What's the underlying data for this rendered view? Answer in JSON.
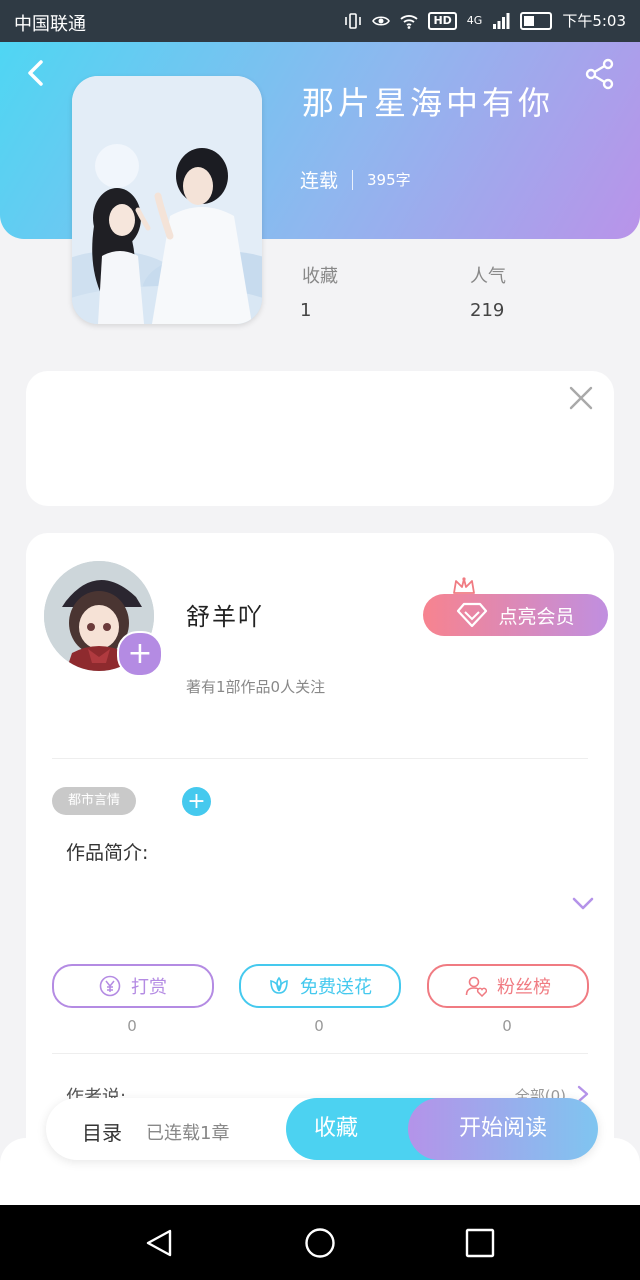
{
  "status_bar": {
    "carrier": "中国联通",
    "network": "4G",
    "hd": "HD",
    "time": "下午5:03"
  },
  "book": {
    "title": "那片星海中有你",
    "status": "连载",
    "word_count": "395字",
    "stats": [
      {
        "label": "收藏",
        "value": "1"
      },
      {
        "label": "人气",
        "value": "219"
      }
    ]
  },
  "author": {
    "name": "舒羊吖",
    "info": "著有1部作品0人关注",
    "follow_glyph": "+",
    "vip_label": "点亮会员"
  },
  "tags": [
    "都市言情"
  ],
  "tag_add_glyph": "+",
  "intro_label": "作品简介:",
  "actions": [
    {
      "label": "打赏",
      "count": "0",
      "icon": "yen-icon",
      "color": "#b48be3"
    },
    {
      "label": "免费送花",
      "count": "0",
      "icon": "flower-icon",
      "color": "#45c9ee"
    },
    {
      "label": "粉丝榜",
      "count": "0",
      "icon": "user-heart-icon",
      "color": "#f07b82"
    }
  ],
  "author_said": {
    "label": "作者说:",
    "chapters": "全部(0)"
  },
  "bottom_bar": {
    "toc_label": "目录",
    "toc_status": "已连载1章",
    "collect_label": "收藏",
    "read_label": "开始阅读"
  },
  "colors": {
    "accent_blue": "#4cd2f1",
    "accent_purple": "#b493e9",
    "accent_pink": "#f7838f"
  }
}
